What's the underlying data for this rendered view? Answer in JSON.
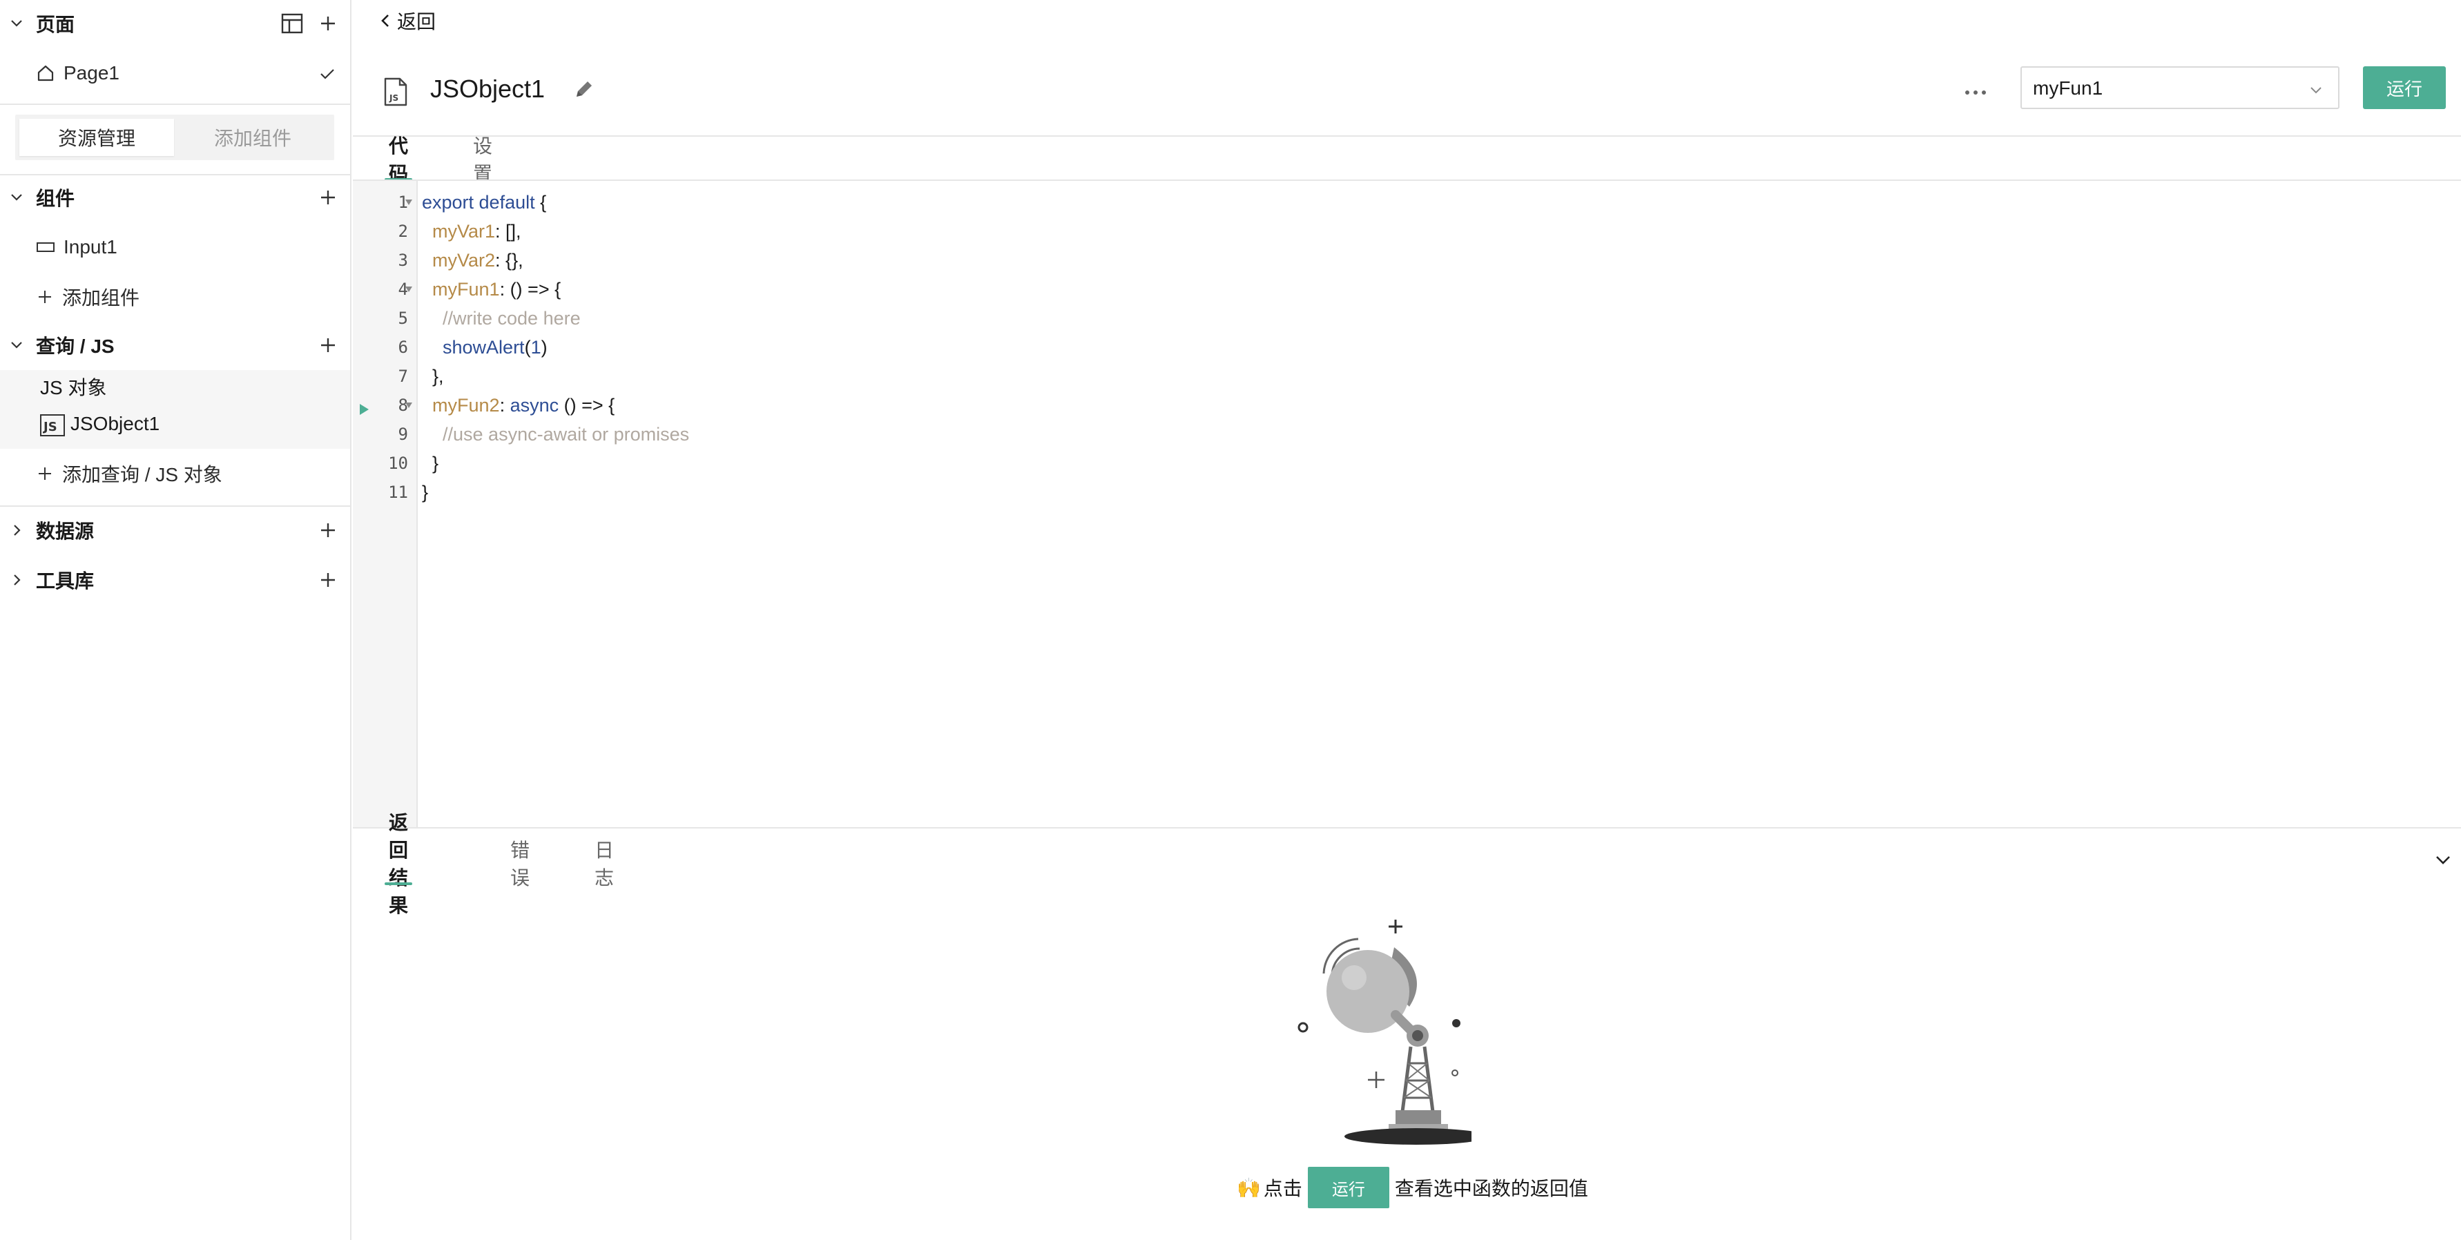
{
  "sidebar": {
    "pages_section": {
      "label": "页面"
    },
    "pages": [
      {
        "label": "Page1"
      }
    ],
    "resource_tabs": {
      "active": "资源管理",
      "inactive": "添加组件"
    },
    "widgets_section": {
      "label": "组件"
    },
    "widgets": [
      {
        "label": "Input1"
      }
    ],
    "add_widget_label": "添加组件",
    "queries_section": {
      "label": "查询 / JS"
    },
    "js_group_label": "JS 对象",
    "js_objects": [
      {
        "label": "JSObject1"
      }
    ],
    "add_query_label": "添加查询 / JS 对象",
    "datasources_section": {
      "label": "数据源"
    },
    "libraries_section": {
      "label": "工具库"
    }
  },
  "header": {
    "back_label": "返回",
    "object_name": "JSObject1",
    "selected_function": "myFun1",
    "run_label": "运行"
  },
  "editor_tabs": {
    "code": "代码",
    "settings": "设置"
  },
  "code": {
    "lines": [
      "1",
      "2",
      "3",
      "4",
      "5",
      "6",
      "7",
      "8",
      "9",
      "10",
      "11"
    ]
  },
  "result_panel": {
    "tabs": {
      "result": "返回结果",
      "errors": "错误",
      "logs": "日志"
    },
    "hint_prefix_emoji": "🙌",
    "hint_click": "点击",
    "hint_run": "运行",
    "hint_suffix": "查看选中函数的返回值"
  },
  "colors": {
    "accent": "#4dae94",
    "keyword": "#2d4d94",
    "property": "#b58a48",
    "comment": "#b0a8a0"
  }
}
